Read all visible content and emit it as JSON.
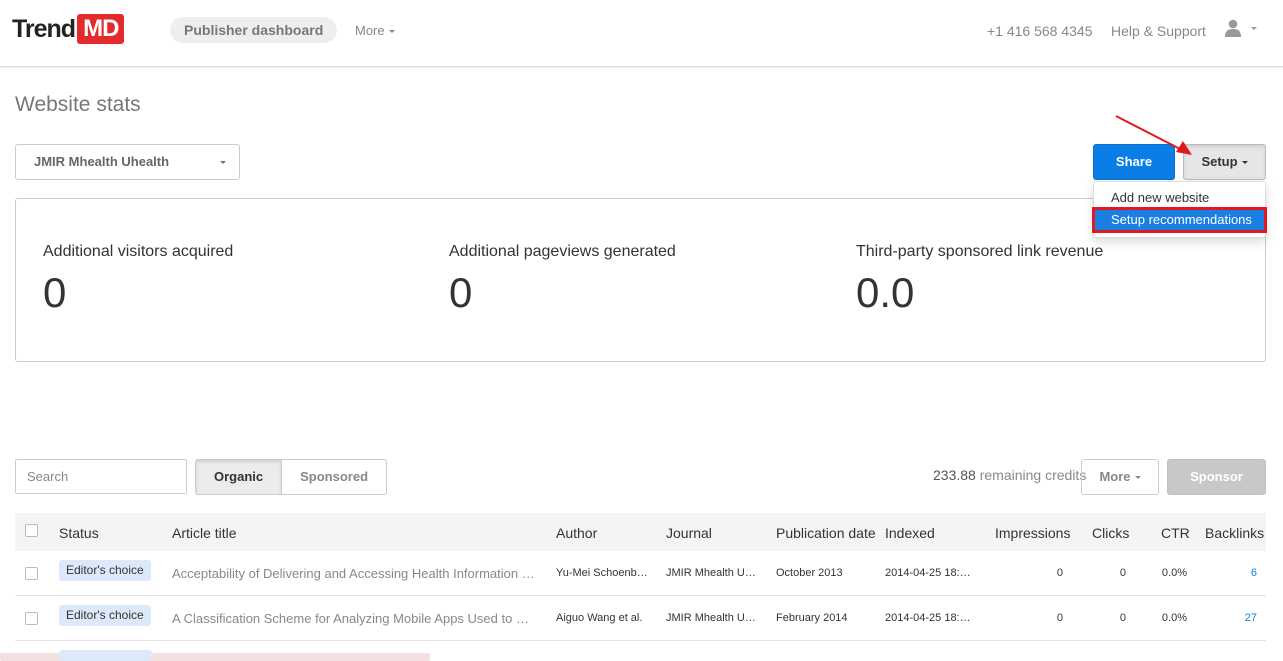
{
  "nav": {
    "logo_trend": "Trend",
    "logo_md": "MD",
    "publisher_dashboard": "Publisher dashboard",
    "more": "More",
    "phone": "+1 416 568 4345",
    "help": "Help & Support"
  },
  "page": {
    "title": "Website stats"
  },
  "site_select": {
    "value": "JMIR Mhealth Uhealth"
  },
  "buttons": {
    "share": "Share",
    "setup": "Setup"
  },
  "setup_menu": {
    "items": [
      "Add new website",
      "Setup recommendations"
    ]
  },
  "stats": [
    {
      "label": "Additional visitors acquired",
      "value": "0"
    },
    {
      "label": "Additional pageviews generated",
      "value": "0"
    },
    {
      "label": "Third-party sponsored link revenue",
      "value": "0.0"
    }
  ],
  "toolbar": {
    "search_placeholder": "Search",
    "organic": "Organic",
    "sponsored": "Sponsored",
    "credits_value": "233.88",
    "credits_text": "remaining credits",
    "more": "More",
    "sponsor": "Sponsor"
  },
  "table": {
    "columns": [
      "Status",
      "Article title",
      "Author",
      "Journal",
      "Publication date",
      "Indexed",
      "Impressions",
      "Clicks",
      "CTR",
      "Backlinks"
    ],
    "rows": [
      {
        "status": "Editor's choice",
        "title": "Acceptability of Delivering and Accessing Health Information …",
        "author": "Yu-Mei Schoenb…",
        "journal": "JMIR Mhealth U…",
        "pub_date": "October 2013",
        "indexed": "2014-04-25 18:…",
        "impressions": "0",
        "clicks": "0",
        "ctr": "0.0%",
        "backlinks": "6"
      },
      {
        "status": "Editor's choice",
        "title": "A Classification Scheme for Analyzing Mobile Apps Used to Pr…",
        "author": "Aiguo Wang et al.",
        "journal": "JMIR Mhealth U…",
        "pub_date": "February 2014",
        "indexed": "2014-04-25 18:…",
        "impressions": "0",
        "clicks": "0",
        "ctr": "0.0%",
        "backlinks": "27"
      }
    ]
  },
  "colors": {
    "brand_red": "#e32b2b",
    "primary_blue": "#0a7ee6",
    "highlight_red": "#e0191e"
  },
  "icons": [
    "user-icon",
    "caret-down-icon",
    "annotation-arrow-icon"
  ]
}
